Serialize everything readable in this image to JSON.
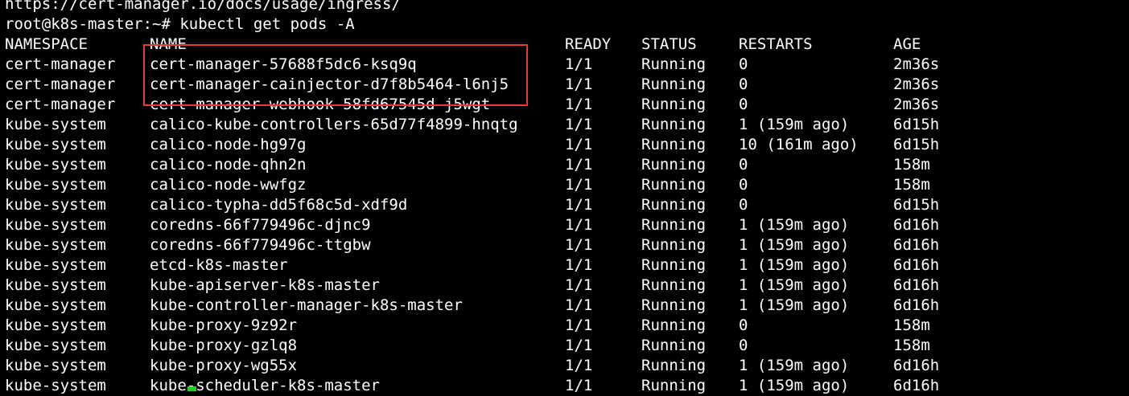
{
  "terminal": {
    "clipped_previous_line": "https://cert-manager.io/docs/usage/ingress/",
    "prompt": "root@k8s-master:~# kubectl get pods -A",
    "columns": {
      "namespace": "NAMESPACE",
      "name": "NAME",
      "ready": "READY",
      "status": "STATUS",
      "restarts": "RESTARTS",
      "age": "AGE"
    },
    "rows": [
      {
        "namespace": "cert-manager",
        "name": "cert-manager-57688f5dc6-ksq9q",
        "ready": "1/1",
        "status": "Running",
        "restarts": "0",
        "age": "2m36s"
      },
      {
        "namespace": "cert-manager",
        "name": "cert-manager-cainjector-d7f8b5464-l6nj5",
        "ready": "1/1",
        "status": "Running",
        "restarts": "0",
        "age": "2m36s"
      },
      {
        "namespace": "cert-manager",
        "name": "cert-manager-webhook-58fd67545d-j5wgt",
        "ready": "1/1",
        "status": "Running",
        "restarts": "0",
        "age": "2m36s"
      },
      {
        "namespace": "kube-system",
        "name": "calico-kube-controllers-65d77f4899-hnqtg",
        "ready": "1/1",
        "status": "Running",
        "restarts": "1 (159m ago)",
        "age": "6d15h"
      },
      {
        "namespace": "kube-system",
        "name": "calico-node-hg97g",
        "ready": "1/1",
        "status": "Running",
        "restarts": "10 (161m ago)",
        "age": "6d15h"
      },
      {
        "namespace": "kube-system",
        "name": "calico-node-qhn2n",
        "ready": "1/1",
        "status": "Running",
        "restarts": "0",
        "age": "158m"
      },
      {
        "namespace": "kube-system",
        "name": "calico-node-wwfgz",
        "ready": "1/1",
        "status": "Running",
        "restarts": "0",
        "age": "158m"
      },
      {
        "namespace": "kube-system",
        "name": "calico-typha-dd5f68c5d-xdf9d",
        "ready": "1/1",
        "status": "Running",
        "restarts": "0",
        "age": "6d15h"
      },
      {
        "namespace": "kube-system",
        "name": "coredns-66f779496c-djnc9",
        "ready": "1/1",
        "status": "Running",
        "restarts": "1 (159m ago)",
        "age": "6d16h"
      },
      {
        "namespace": "kube-system",
        "name": "coredns-66f779496c-ttgbw",
        "ready": "1/1",
        "status": "Running",
        "restarts": "1 (159m ago)",
        "age": "6d16h"
      },
      {
        "namespace": "kube-system",
        "name": "etcd-k8s-master",
        "ready": "1/1",
        "status": "Running",
        "restarts": "1 (159m ago)",
        "age": "6d16h"
      },
      {
        "namespace": "kube-system",
        "name": "kube-apiserver-k8s-master",
        "ready": "1/1",
        "status": "Running",
        "restarts": "1 (159m ago)",
        "age": "6d16h"
      },
      {
        "namespace": "kube-system",
        "name": "kube-controller-manager-k8s-master",
        "ready": "1/1",
        "status": "Running",
        "restarts": "1 (159m ago)",
        "age": "6d16h"
      },
      {
        "namespace": "kube-system",
        "name": "kube-proxy-9z92r",
        "ready": "1/1",
        "status": "Running",
        "restarts": "0",
        "age": "158m"
      },
      {
        "namespace": "kube-system",
        "name": "kube-proxy-gzlq8",
        "ready": "1/1",
        "status": "Running",
        "restarts": "0",
        "age": "158m"
      },
      {
        "namespace": "kube-system",
        "name": "kube-proxy-wg55x",
        "ready": "1/1",
        "status": "Running",
        "restarts": "1 (159m ago)",
        "age": "6d16h"
      },
      {
        "namespace": "kube-system",
        "name": "kube-scheduler-k8s-master",
        "ready": "1/1",
        "status": "Running",
        "restarts": "1 (159m ago)",
        "age": "6d16h"
      }
    ]
  },
  "colors": {
    "background": "#000000",
    "text": "#ffffff",
    "highlight_border": "#e03c3c",
    "cursor": "#22cc22"
  }
}
